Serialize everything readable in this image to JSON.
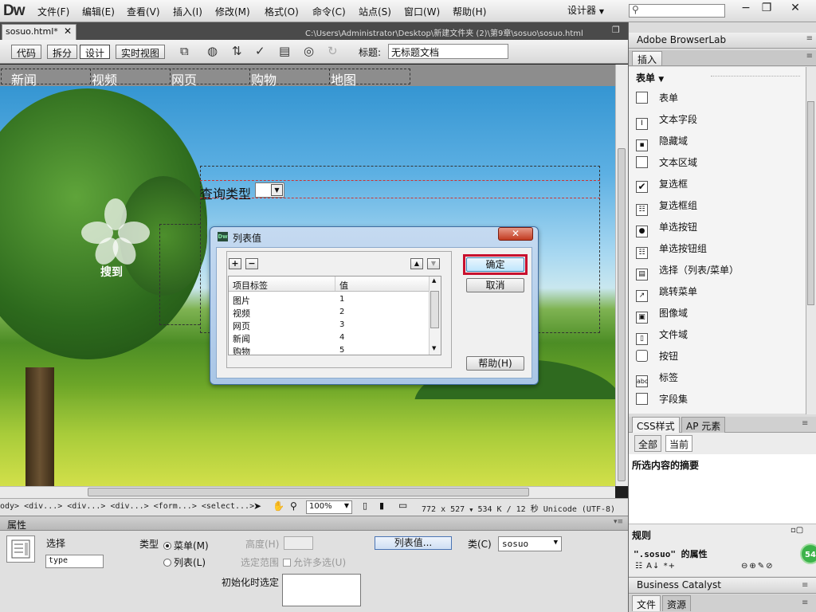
{
  "app": {
    "logo": "Dw",
    "menu": [
      "文件(F)",
      "编辑(E)",
      "查看(V)",
      "插入(I)",
      "修改(M)",
      "格式(O)",
      "命令(C)",
      "站点(S)",
      "窗口(W)",
      "帮助(H)"
    ],
    "workspace": "设计器",
    "search_placeholder": ""
  },
  "document": {
    "tab": "sosuo.html*",
    "path": "C:\\Users\\Administrator\\Desktop\\新建文件夹 (2)\\第9章\\sosuo\\sosuo.html"
  },
  "toolbar": {
    "views": [
      "代码",
      "拆分",
      "设计",
      "实时视图"
    ],
    "active_view": "设计",
    "title_label": "标题:",
    "title_value": "无标题文档"
  },
  "canvas": {
    "nav": [
      "新闻",
      "视频",
      "网页",
      "购物",
      "地图"
    ],
    "logo_text": "搜到",
    "query_label": "查询类型"
  },
  "dialog": {
    "title": "列表值",
    "close_label": "✕",
    "col_label": "项目标签",
    "col_value": "值",
    "rows": [
      {
        "label": "图片",
        "value": "1"
      },
      {
        "label": "视频",
        "value": "2"
      },
      {
        "label": "网页",
        "value": "3"
      },
      {
        "label": "新闻",
        "value": "4"
      },
      {
        "label": "购物",
        "value": "5"
      }
    ],
    "ok_label": "确定",
    "cancel_label": "取消",
    "help_label": "帮助(H)"
  },
  "statusbar": {
    "tagpath": "ody> <div...> <div...> <div...> <form...> <select...>",
    "zoom": "100%",
    "size": "772 x 527",
    "file": "534 K / 12 秒",
    "encoding": "Unicode (UTF-8)"
  },
  "properties": {
    "title": "属性",
    "element_type": "选择",
    "name_value": "type",
    "type_label": "类型",
    "menu_option": "菜单(M)",
    "list_option": "列表(L)",
    "height_label": "高度(H)",
    "select_range_label": "选定范围",
    "allow_multi_label": "允许多选(U)",
    "list_values_button": "列表值...",
    "class_label": "类(C)",
    "class_value": "sosuo",
    "initial_label": "初始化时选定"
  },
  "right_panel": {
    "browserlab": "Adobe BrowserLab",
    "insert_tab": "插入",
    "category": "表单",
    "items": [
      {
        "label": "表单",
        "icon": "form-icon"
      },
      {
        "label": "文本字段",
        "icon": "text-field-icon"
      },
      {
        "label": "隐藏域",
        "icon": "hidden-field-icon"
      },
      {
        "label": "文本区域",
        "icon": "textarea-icon"
      },
      {
        "label": "复选框",
        "icon": "checkbox-icon"
      },
      {
        "label": "复选框组",
        "icon": "checkbox-group-icon"
      },
      {
        "label": "单选按钮",
        "icon": "radio-icon"
      },
      {
        "label": "单选按钮组",
        "icon": "radio-group-icon"
      },
      {
        "label": "选择（列表/菜单）",
        "icon": "select-icon"
      },
      {
        "label": "跳转菜单",
        "icon": "jump-menu-icon"
      },
      {
        "label": "图像域",
        "icon": "image-field-icon"
      },
      {
        "label": "文件域",
        "icon": "file-field-icon"
      },
      {
        "label": "按钮",
        "icon": "button-icon"
      },
      {
        "label": "标签",
        "icon": "label-icon"
      },
      {
        "label": "字段集",
        "icon": "fieldset-icon"
      }
    ],
    "css_tab": "CSS样式",
    "ap_tab": "AP 元素",
    "all_btn": "全部",
    "current_btn": "当前",
    "summary": "所选内容的摘要",
    "rules": "规则",
    "rule_props": "\".sosuo\" 的属性",
    "business_catalyst": "Business Catalyst",
    "files_tab": "文件",
    "assets_tab": "资源",
    "badge": "54"
  }
}
